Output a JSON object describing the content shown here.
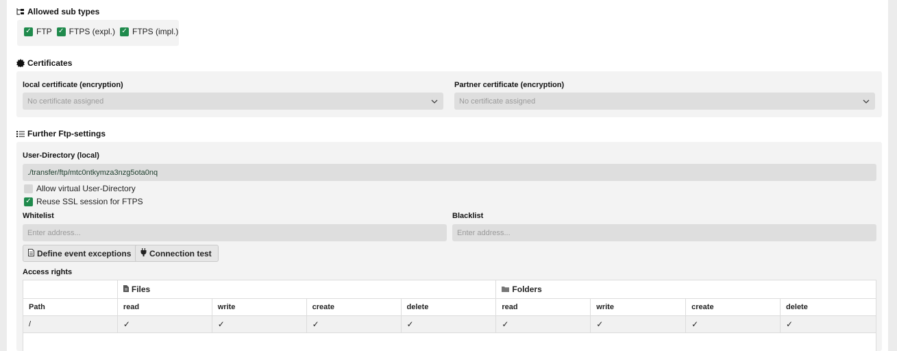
{
  "sub_types": {
    "title": "Allowed sub types",
    "icon": "sitemap-icon",
    "options": [
      {
        "label": "FTP",
        "checked": true
      },
      {
        "label": "FTPS (expl.)",
        "checked": true
      },
      {
        "label": "FTPS (impl.)",
        "checked": true
      }
    ]
  },
  "certificates": {
    "title": "Certificates",
    "icon": "certificate-seal-icon",
    "local_label": "local certificate (encryption)",
    "local_placeholder": "No certificate assigned",
    "partner_label": "Partner certificate (encryption)",
    "partner_placeholder": "No certificate assigned"
  },
  "ftp_settings": {
    "title": "Further Ftp-settings",
    "icon": "list-icon",
    "user_dir_label": "User-Directory (local)",
    "user_dir_value": "./transfer/ftp/mtc0ntkymza3nzg5ota0nq",
    "virtual_dir": {
      "label": "Allow virtual User-Directory",
      "checked": false
    },
    "reuse_ssl": {
      "label": "Reuse SSL session for FTPS",
      "checked": true
    },
    "whitelist_label": "Whitelist",
    "whitelist_placeholder": "Enter address...",
    "blacklist_label": "Blacklist",
    "blacklist_placeholder": "Enter address...",
    "event_exceptions_button": "Define event exceptions",
    "connection_test_button": "Connection test",
    "access_rights_label": "Access rights"
  },
  "access_rights": {
    "files_group": "Files",
    "folders_group": "Folders",
    "path_header": "Path",
    "columns": [
      "read",
      "write",
      "create",
      "delete",
      "read",
      "write",
      "create",
      "delete"
    ],
    "rows": [
      {
        "path": "/",
        "rights": [
          "✓",
          "✓",
          "✓",
          "✓",
          "✓",
          "✓",
          "✓",
          "✓"
        ]
      }
    ]
  },
  "colors": {
    "accent_green": "#1f8a4c",
    "panel_bg": "#f3f3f3",
    "input_bg": "#dedede"
  }
}
